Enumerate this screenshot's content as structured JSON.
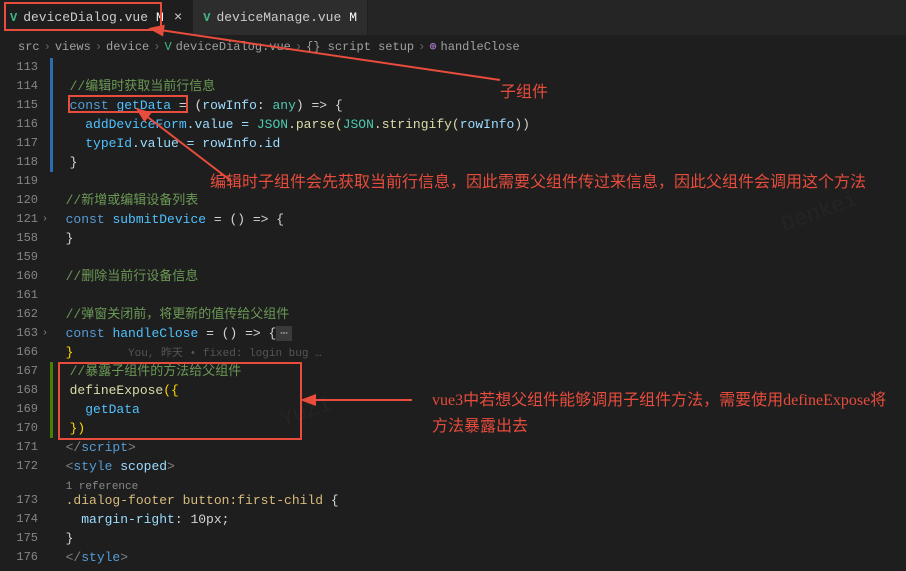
{
  "tabs": [
    {
      "name": "deviceDialog.vue",
      "modified": "M",
      "active": true
    },
    {
      "name": "deviceManage.vue",
      "modified": "M",
      "active": false
    }
  ],
  "breadcrumb": {
    "parts": [
      "src",
      "views",
      "device",
      "deviceDialog.vue",
      "{} script setup",
      "handleClose"
    ],
    "methodIcon": "⊕"
  },
  "lines": {
    "l113": "113",
    "l114": "114",
    "l115": "115",
    "l116": "116",
    "l117": "117",
    "l118": "118",
    "l119": "119",
    "l120": "120",
    "l121": "121",
    "l158": "158",
    "l159": "159",
    "l160": "160",
    "l161": "161",
    "l162": "162",
    "l163": "163",
    "l166": "166",
    "l167": "167",
    "l168": "168",
    "l169": "169",
    "l170": "170",
    "l171": "171",
    "l172": "172",
    "l173": "173",
    "l174": "174",
    "l175": "175",
    "l176": "176"
  },
  "code": {
    "c114": "//编辑时获取当前行信息",
    "c115_const": "const",
    "c115_name": "getData",
    "c115_eq": " = (",
    "c115_param": "rowInfo",
    "c115_colon": ": ",
    "c115_type": "any",
    "c115_arrow": ") => {",
    "c116_var": "addDeviceForm",
    "c116_value": ".value = ",
    "c116_json": "JSON",
    "c116_parse": ".parse(",
    "c116_json2": "JSON",
    "c116_stringify": ".stringify(",
    "c116_arg": "rowInfo",
    "c116_end": "))",
    "c117_var": "typeId",
    "c117_value": ".value = ",
    "c117_arg": "rowInfo",
    "c117_id": ".id",
    "c118": "}",
    "c120": "//新增或编辑设备列表",
    "c121_const": "const",
    "c121_name": "submitDevice",
    "c121_rest": " = () => {",
    "c158": "}",
    "c160": "//删除当前行设备信息",
    "c162": "//弹窗关闭前，将更新的值传给父组件",
    "c163_const": "const",
    "c163_name": "handleClose",
    "c163_rest": " = () => {",
    "c163_dots": "⋯",
    "c166": "}",
    "c166_ghost": "You, 昨天 • fixed: login bug …",
    "c167": "//暴露子组件的方法给父组件",
    "c168_fn": "defineExpose",
    "c168_open": "({",
    "c169": "getData",
    "c170": "})",
    "c171_open": "</",
    "c171_tag": "script",
    "c171_close": ">",
    "c172_open": "<",
    "c172_tag": "style",
    "c172_attr": " scoped",
    "c172_close": ">",
    "c172_ref": "1 reference",
    "c173_sel": ".dialog-footer button:first-child",
    "c173_brace": " {",
    "c174_prop": "margin-right",
    "c174_val": ": 10px;",
    "c175": "}",
    "c176_open": "</",
    "c176_tag": "style",
    "c176_close": ">"
  },
  "annotations": {
    "a1": "子组件",
    "a2": "编辑时子组件会先获取当前行信息，因此需要父组件传过来信息，因此父组件会调用这个方法",
    "a3": "vue3中若想父组件能够调用子组件方法，需要使用defineExpose将方法暴露出去"
  }
}
